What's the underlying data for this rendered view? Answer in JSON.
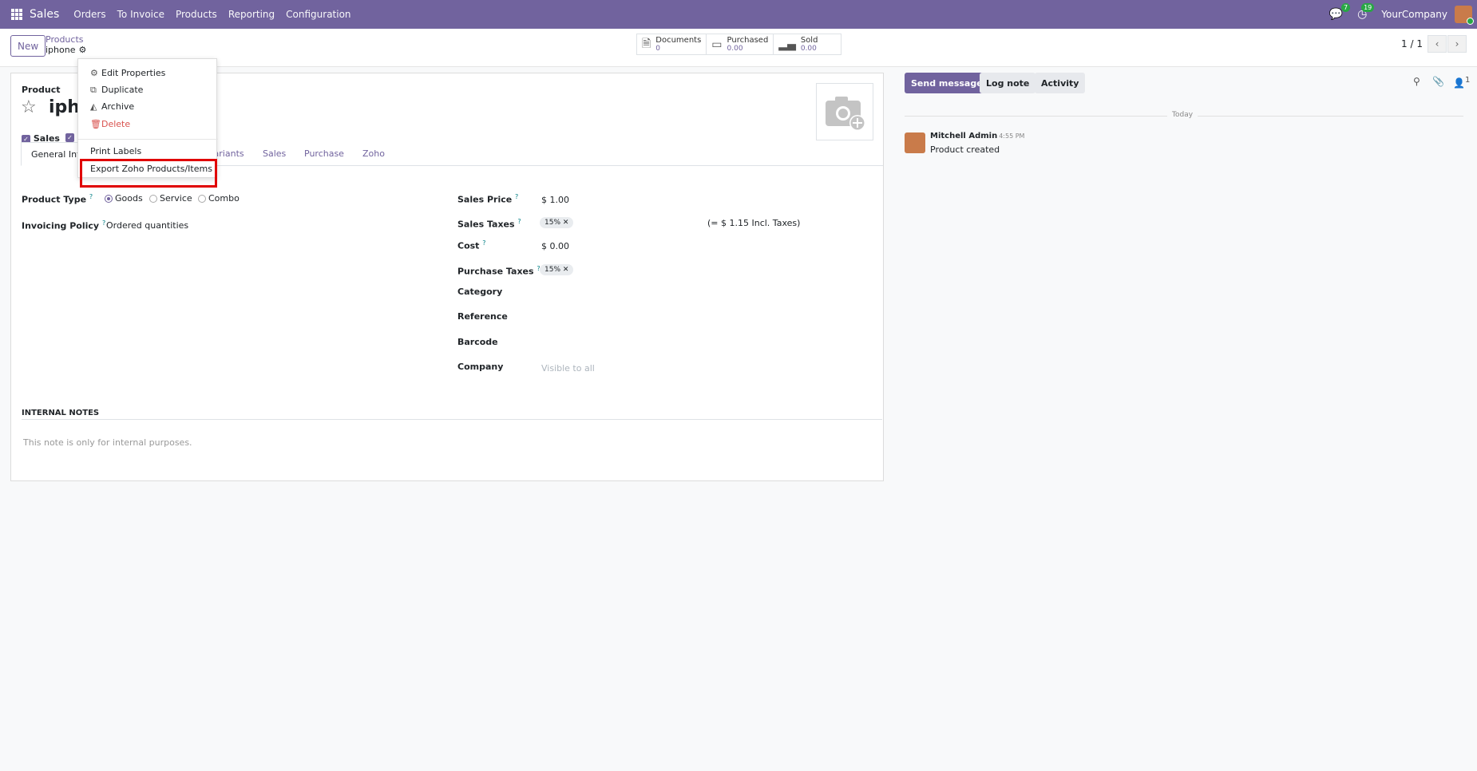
{
  "navbar": {
    "brand": "Sales",
    "menus": [
      "Orders",
      "To Invoice",
      "Products",
      "Reporting",
      "Configuration"
    ],
    "messages_count": "7",
    "activities_count": "19",
    "company": "YourCompany",
    "color": "#71639e"
  },
  "control_panel": {
    "new_label": "New",
    "breadcrumb_parent": "Products",
    "breadcrumb_current": "iphone",
    "smart_buttons": [
      {
        "label": "Documents",
        "value": "0",
        "icon": "document-icon"
      },
      {
        "label": "Purchased",
        "value": "0.00",
        "icon": "credit-card-icon"
      },
      {
        "label": "Sold",
        "value": "0.00",
        "icon": "signal-bars-icon"
      }
    ],
    "pager": "1 / 1"
  },
  "form": {
    "product_label": "Product",
    "name": "iphone",
    "sales_checkbox_label": "Sales",
    "tabs": [
      "General Information",
      "Attributes & Variants",
      "Sales",
      "Purchase",
      "Zoho"
    ],
    "product_type_label": "Product Type",
    "product_type_options": [
      "Goods",
      "Service",
      "Combo"
    ],
    "product_type_selected": "Goods",
    "invoicing_policy_label": "Invoicing Policy",
    "invoicing_policy_value": "Ordered quantities",
    "sales_price_label": "Sales Price",
    "sales_price_value": "$ 1.00",
    "sales_taxes_label": "Sales Taxes",
    "sales_taxes_tag": "15%",
    "incl_taxes": "(= $ 1.15 Incl. Taxes)",
    "cost_label": "Cost",
    "cost_value": "$ 0.00",
    "purchase_taxes_label": "Purchase Taxes",
    "purchase_taxes_tag": "15%",
    "category_label": "Category",
    "reference_label": "Reference",
    "barcode_label": "Barcode",
    "company_label": "Company",
    "company_placeholder": "Visible to all",
    "internal_notes_title": "INTERNAL NOTES",
    "internal_notes_placeholder": "This note is only for internal purposes."
  },
  "dropdown": {
    "items": [
      "Edit Properties",
      "Duplicate",
      "Archive",
      "Delete",
      "Print Labels",
      "Export Zoho Products/Items"
    ]
  },
  "chatter": {
    "send_message": "Send message",
    "log_note": "Log note",
    "activity": "Activity",
    "followers_count": "1",
    "date_separator": "Today",
    "message": {
      "author": "Mitchell Admin",
      "time": "4:55 PM",
      "body": "Product created"
    }
  }
}
